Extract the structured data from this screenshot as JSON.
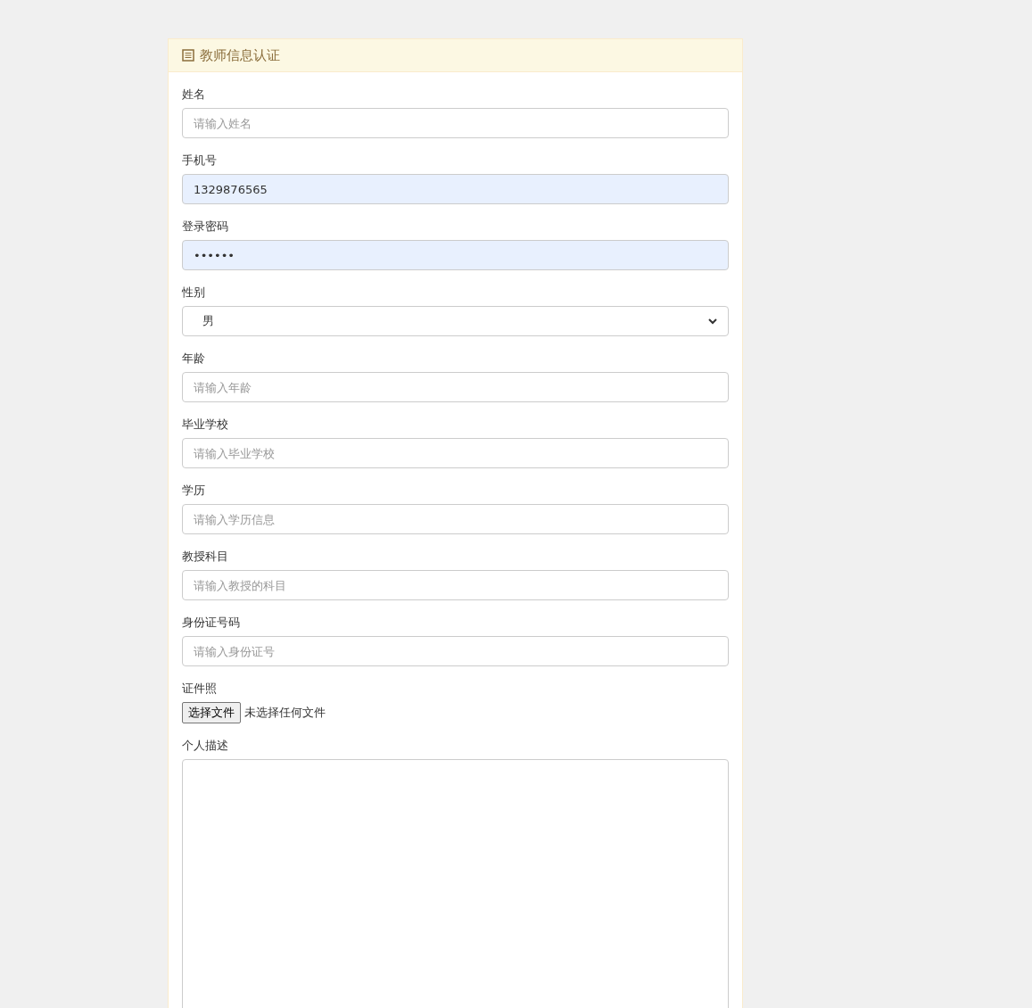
{
  "panel": {
    "title": "教师信息认证"
  },
  "fields": [
    {
      "kind": "text",
      "label": "姓名",
      "placeholder": "请输入姓名",
      "autofilled": false
    },
    {
      "kind": "text",
      "label": "手机号",
      "value": "1329876565",
      "autofilled": true
    },
    {
      "kind": "text",
      "label": "登录密码",
      "value": "••••••",
      "autofilled": true
    },
    {
      "kind": "select",
      "label": "性别",
      "value": "男"
    },
    {
      "kind": "text",
      "label": "年龄",
      "placeholder": "请输入年龄",
      "autofilled": false
    },
    {
      "kind": "text",
      "label": "毕业学校",
      "placeholder": "请输入毕业学校",
      "autofilled": false
    },
    {
      "kind": "text",
      "label": "学历",
      "placeholder": "请输入学历信息",
      "autofilled": false
    },
    {
      "kind": "text",
      "label": "教授科目",
      "placeholder": "请输入教授的科目",
      "autofilled": false
    },
    {
      "kind": "text",
      "label": "身份证号码",
      "placeholder": "请输入身份证号",
      "autofilled": false
    },
    {
      "kind": "file",
      "label": "证件照",
      "button": "选择文件",
      "status": "未选择任何文件"
    },
    {
      "kind": "textarea",
      "label": "个人描述"
    }
  ]
}
